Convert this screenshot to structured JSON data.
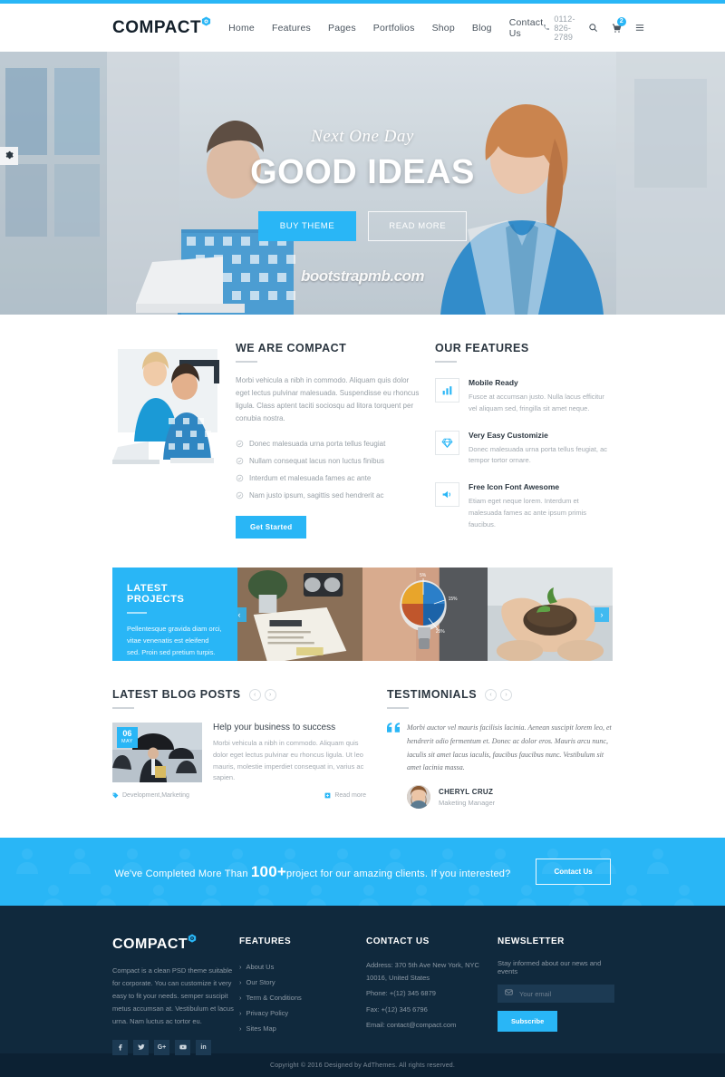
{
  "nav": {
    "brand": "COMPACT",
    "links": [
      "Home",
      "Features",
      "Pages",
      "Portfolios",
      "Shop",
      "Blog",
      "Contact Us"
    ],
    "phone": "0112-826-2789",
    "cart_count": "2",
    "icons": {
      "phone": "phone-icon",
      "search": "search-icon",
      "cart": "cart-icon",
      "menu": "hamburger-icon"
    },
    "accent": "#29b6f6"
  },
  "hero": {
    "subtitle": "Next One Day",
    "title": "GOOD IDEAS",
    "primary_btn": "BUY THEME",
    "secondary_btn": "READ MORE",
    "watermark": "bootstrapmb.com",
    "settings_icon": "gear-icon"
  },
  "about": {
    "title": "WE ARE COMPACT",
    "body": "Morbi vehicula a nibh in commodo. Aliquam quis dolor eget lectus pulvinar malesuada. Suspendisse eu rhoncus ligula. Class aptent taciti sociosqu ad litora torquent per conubia nostra.",
    "checklist": [
      "Donec malesuada urna porta tellus feugiat",
      "Nullam consequat lacus non luctus finibus",
      "Interdum et malesuada fames ac ante",
      "Nam justo ipsum, sagittis sed hendrerit ac"
    ],
    "button": "Get Started"
  },
  "features": {
    "title": "OUR FEATURES",
    "items": [
      {
        "icon": "bar-chart-icon",
        "title": "Mobile Ready",
        "text": "Fusce at accumsan justo. Nulla lacus efficitur vel aliquam sed, fringilla sit amet neque."
      },
      {
        "icon": "diamond-icon",
        "title": "Very Easy Customizie",
        "text": "Donec malesuada urna porta tellus feugiat, ac tempor tortor ornare."
      },
      {
        "icon": "megaphone-icon",
        "title": "Free Icon Font Awesome",
        "text": "Etiam eget neque lorem. Interdum et malesuada fames ac ante ipsum primis faucibus."
      }
    ]
  },
  "projects": {
    "title": "LATEST PROJECTS",
    "text": "Pellentesque gravida diam orci, vitae venenatis est eleifend sed. Proin sed pretium turpis.",
    "prev": "‹",
    "next": "›"
  },
  "blog": {
    "title": "LATEST BLOG POSTS",
    "prev": "‹",
    "next": "›",
    "post": {
      "day": "06",
      "month": "MAY",
      "title": "Help your business to success",
      "excerpt": "Morbi vehicula a nibh in commodo. Aliquam quis dolor eget lectus pulvinar eu rhoncus ligula. Ut leo mauris, molestie imperdiet consequat in, varius ac sapien.",
      "tags": "Development,Marketing",
      "read_more": "Read more",
      "tag_icon": "tag-icon",
      "read_icon": "plus-square-icon"
    }
  },
  "testimonials": {
    "title": "TESTIMONIALS",
    "prev": "‹",
    "next": "›",
    "quote_mark": "“",
    "quote": "Morbi auctor vel mauris facilisis lacinia. Aenean suscipit lorem leo, et hendrerit odio fermentum et. Donec ac dolor eros. Mauris arcu nunc, iaculis sit amet lacus iaculis, faucibus faucibus nunc. Vestibulum sit amet lacinia massa.",
    "author": "CHERYL CRUZ",
    "role": "Maketing Manager"
  },
  "cta": {
    "pre": "We've Completed More Than ",
    "count": "100+",
    "post": "project for our amazing clients. If you interested?",
    "button": "Contact Us"
  },
  "footer": {
    "brand": "COMPACT",
    "about": "Compact is a clean PSD theme suitable for corporate. You can customize it very easy to fit your needs. semper suscipit metus accumsan at. Vestibulum et lacus urna. Nam luctus ac tortor eu.",
    "socials": [
      {
        "name": "facebook-icon",
        "glyph": "f"
      },
      {
        "name": "twitter-icon",
        "glyph": "✈"
      },
      {
        "name": "google-plus-icon",
        "glyph": "G+"
      },
      {
        "name": "youtube-icon",
        "glyph": "▶"
      },
      {
        "name": "linkedin-icon",
        "glyph": "in"
      }
    ],
    "features_title": "FEATURES",
    "features_links": [
      "About Us",
      "Our Story",
      "Term & Conditions",
      "Privacy Policy",
      "Sites Map"
    ],
    "contact_title": "CONTACT US",
    "contact": {
      "address": "Address: 370 5th Ave New York, NYC 10016, United States",
      "phone": "Phone: +(12) 345 6879",
      "fax": "Fax: +(12) 345 6796",
      "email": "Email: contact@compact.com"
    },
    "newsletter_title": "NEWSLETTER",
    "newsletter_text": "Stay informed about our news and events",
    "email_placeholder": "Your email",
    "email_value": "",
    "subscribe": "Subscribe",
    "envelope_icon": "envelope-icon",
    "copyright": "Copyright © 2016 Designed by AdThemes. All rights reserved."
  }
}
